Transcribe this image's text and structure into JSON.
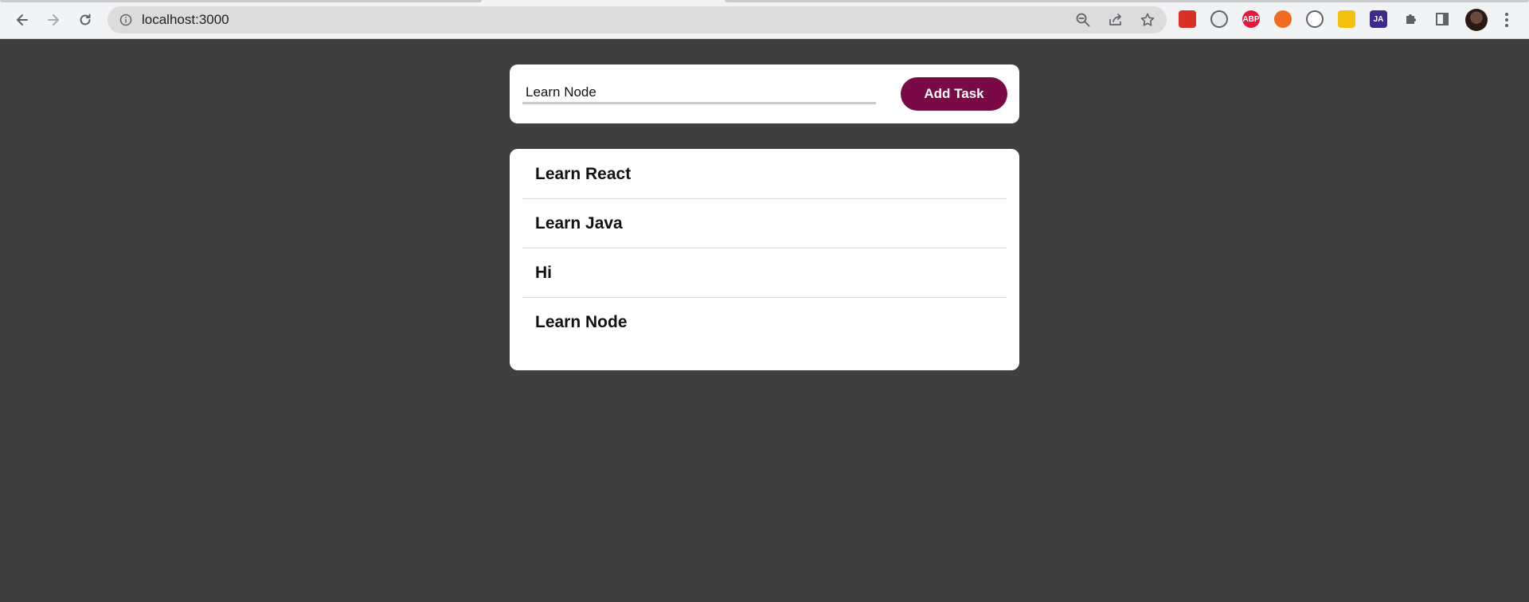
{
  "browser": {
    "url": "localhost:3000",
    "extensions": [
      {
        "name": "ext-red-icon",
        "label": "",
        "color": "#d93025"
      },
      {
        "name": "ext-white-icon",
        "label": "",
        "color": "#e8eaed"
      },
      {
        "name": "adblock-plus-icon",
        "label": "ABP",
        "color": "#e8173c"
      },
      {
        "name": "ext-orange-icon",
        "label": "",
        "color": "#f26a21"
      },
      {
        "name": "ext-circle-icon",
        "label": "",
        "color": "#ffffff"
      },
      {
        "name": "highlighter-icon",
        "label": "",
        "color": "#f4c20d"
      },
      {
        "name": "ja-extension-icon",
        "label": "JA",
        "color": "#3d2a8c"
      }
    ]
  },
  "app": {
    "input_value": "Learn Node",
    "add_button_label": "Add Task",
    "accent_color": "#7a0a45",
    "tasks": [
      "Learn React",
      "Learn Java",
      "Hi",
      "Learn Node"
    ]
  }
}
